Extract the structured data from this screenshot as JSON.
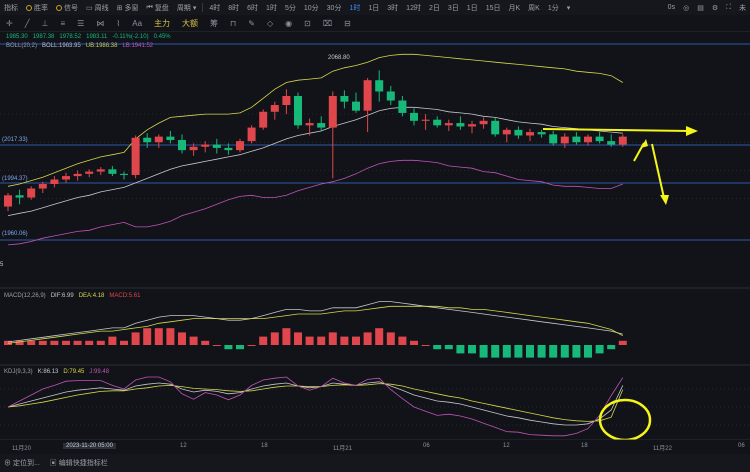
{
  "toolbar": {
    "left_items": [
      "指标",
      "胜率",
      "信号",
      "周线",
      "多窗",
      "复盘",
      "周期"
    ],
    "timeframes": [
      "4时",
      "8时",
      "6时",
      "1时",
      "5分",
      "10分",
      "30分",
      "1时",
      "1日",
      "3时",
      "12时",
      "2日",
      "3日",
      "1日",
      "15日",
      "月K",
      "周K",
      "1分"
    ],
    "active_timeframe_index": 7,
    "right_label": "0s",
    "far_right_label": "未"
  },
  "tools": {
    "labels": [
      "Aa",
      "主力",
      "大额",
      "筹"
    ],
    "icons": [
      "cursor-icon",
      "line-icon",
      "ruler-icon",
      "text-icon",
      "magnet-icon",
      "pen-icon",
      "eye-icon",
      "lock-icon",
      "trash-icon",
      "layers-icon",
      "grid-icon",
      "link-icon"
    ]
  },
  "ohlc_line": {
    "open": "1985.30",
    "high": "1987.38",
    "low": "1978.52",
    "close": "1983.11",
    "change": "-0.11%(-2.10)",
    "amplitude": "0.45%"
  },
  "boll": {
    "label": "BOLL(20,2)",
    "boll": "BOLL:1963.95",
    "ub": "UB:1986.38",
    "lb": "LB:1941.52"
  },
  "price_labels": {
    "high_label": "2068.80",
    "level1": "(2017.33)",
    "level2": "(1994.37)",
    "level3": "(1960.06)",
    "left_tick": "5"
  },
  "macd": {
    "label": "MACD(12,26,9)",
    "dif": "DIF:6.99",
    "dea": "DEA:4.18",
    "macd": "MACD:5.61"
  },
  "kdj": {
    "label": "KDJ(9,3,3)",
    "k": "K:86.13",
    "d": "D:79.45",
    "j": "J:99.48"
  },
  "xaxis": {
    "labels": [
      "11月20",
      "2023-11-20 05:00",
      "12",
      "18",
      "11月21",
      "06",
      "12",
      "18",
      "11月22",
      "06"
    ]
  },
  "footer": {
    "left": "定位到...",
    "right": "编辑快捷指标栏"
  },
  "colors": {
    "up": "#e0474c",
    "down": "#16b979",
    "boll_upper": "#d8d84a",
    "boll_mid": "#c5c8cf",
    "boll_lower": "#c054b8",
    "arrow": "#f5f51a",
    "circle": "#f5f51a",
    "level_line": "#3a6fd8"
  },
  "chart_data": {
    "type": "candlestick",
    "candles": [
      [
        1948,
        1960,
        1944,
        1958
      ],
      [
        1958,
        1963,
        1950,
        1956
      ],
      [
        1956,
        1966,
        1954,
        1964
      ],
      [
        1964,
        1970,
        1960,
        1968
      ],
      [
        1968,
        1975,
        1965,
        1972
      ],
      [
        1972,
        1978,
        1969,
        1975
      ],
      [
        1975,
        1980,
        1971,
        1977
      ],
      [
        1977,
        1981,
        1974,
        1979
      ],
      [
        1979,
        1983,
        1976,
        1981
      ],
      [
        1981,
        1984,
        1975,
        1977
      ],
      [
        1977,
        1979,
        1972,
        1976
      ],
      [
        1976,
        2011,
        1973,
        2009
      ],
      [
        2009,
        2013,
        2000,
        2005
      ],
      [
        2005,
        2012,
        2000,
        2010
      ],
      [
        2010,
        2015,
        2004,
        2007
      ],
      [
        2007,
        2012,
        1995,
        1998
      ],
      [
        1998,
        2004,
        1993,
        2001
      ],
      [
        2001,
        2006,
        1996,
        2003
      ],
      [
        2003,
        2008,
        1995,
        2000
      ],
      [
        2000,
        2004,
        1994,
        1998
      ],
      [
        1998,
        2008,
        1996,
        2006
      ],
      [
        2006,
        2020,
        2004,
        2018
      ],
      [
        2018,
        2034,
        2016,
        2032
      ],
      [
        2032,
        2041,
        2025,
        2038
      ],
      [
        2038,
        2052,
        2030,
        2046
      ],
      [
        2046,
        2049,
        2017,
        2020
      ],
      [
        2020,
        2026,
        2011,
        2022
      ],
      [
        2022,
        2028,
        2015,
        2018
      ],
      [
        2018,
        2050,
        1973,
        2046
      ],
      [
        2046,
        2051,
        2035,
        2041
      ],
      [
        2041,
        2049,
        2031,
        2033
      ],
      [
        2033,
        2062,
        2014,
        2060
      ],
      [
        2060,
        2068.8,
        2041,
        2050
      ],
      [
        2050,
        2055,
        2038,
        2042
      ],
      [
        2042,
        2046,
        2028,
        2031
      ],
      [
        2031,
        2035,
        2020,
        2024
      ],
      [
        2024,
        2030,
        2016,
        2025
      ],
      [
        2025,
        2028,
        2018,
        2020
      ],
      [
        2020,
        2025,
        2015,
        2022
      ],
      [
        2022,
        2028,
        2016,
        2019
      ],
      [
        2019,
        2024,
        2013,
        2021
      ],
      [
        2021,
        2027,
        2017,
        2024
      ],
      [
        2024,
        2027,
        2010,
        2012
      ],
      [
        2012,
        2018,
        2005,
        2016
      ],
      [
        2016,
        2019,
        2008,
        2011
      ],
      [
        2011,
        2017,
        2006,
        2014
      ],
      [
        2014,
        2016,
        2009,
        2012
      ],
      [
        2012,
        2015,
        2002,
        2004
      ],
      [
        2004,
        2013,
        2000,
        2010
      ],
      [
        2010,
        2014,
        2003,
        2005
      ],
      [
        2005,
        2012,
        2002,
        2010
      ],
      [
        2010,
        2014,
        2004,
        2006
      ],
      [
        2006,
        2012,
        2001,
        2003
      ],
      [
        2003,
        2012,
        2001,
        2010
      ]
    ],
    "series": [
      {
        "name": "BOLL:1963.95",
        "type": "line",
        "values": [
          1940,
          1942,
          1944,
          1947,
          1950,
          1953,
          1956,
          1958,
          1961,
          1963,
          1965,
          1969,
          1973,
          1977,
          1981,
          1984,
          1986,
          1988,
          1990,
          1992,
          1994,
          1997,
          2000,
          2004,
          2008,
          2011,
          2013,
          2015,
          2019,
          2022,
          2025,
          2029,
          2033,
          2035,
          2036,
          2036,
          2035,
          2034,
          2032,
          2031,
          2030,
          2028,
          2027,
          2025,
          2023,
          2022,
          2021,
          2019,
          2018,
          2017,
          2016,
          2015,
          2014,
          2013
        ]
      },
      {
        "name": "UB:1986.38",
        "type": "line",
        "values": [
          1966,
          1968,
          1971,
          1974,
          1978,
          1982,
          1986,
          1989,
          1992,
          1994,
          1996,
          2008,
          2016,
          2022,
          2027,
          2028,
          2029,
          2030,
          2030,
          2030,
          2031,
          2036,
          2044,
          2052,
          2058,
          2060,
          2061,
          2062,
          2068,
          2071,
          2073,
          2076,
          2080,
          2082,
          2083,
          2083,
          2082,
          2081,
          2080,
          2079,
          2078,
          2077,
          2076,
          2075,
          2074,
          2073,
          2072,
          2071,
          2070,
          2068,
          2067,
          2066,
          2064,
          2058
        ]
      },
      {
        "name": "LB:1941.52",
        "type": "line",
        "values": [
          1914,
          1915,
          1917,
          1920,
          1922,
          1924,
          1926,
          1927,
          1930,
          1932,
          1934,
          1930,
          1930,
          1932,
          1935,
          1940,
          1943,
          1946,
          1950,
          1954,
          1957,
          1958,
          1956,
          1956,
          1958,
          1962,
          1965,
          1968,
          1970,
          1973,
          1977,
          1982,
          1986,
          1988,
          1989,
          1989,
          1988,
          1987,
          1984,
          1983,
          1982,
          1979,
          1978,
          1975,
          1972,
          1971,
          1970,
          1967,
          1966,
          1966,
          1965,
          1964,
          1964,
          1968
        ]
      },
      {
        "name": "DIF:6.99",
        "type": "line",
        "values": [
          2,
          3,
          4,
          5,
          6,
          7,
          8,
          9,
          10,
          11,
          11,
          14,
          16,
          18,
          19,
          19,
          19,
          18,
          17,
          16,
          16,
          17,
          19,
          21,
          23,
          23,
          22,
          22,
          24,
          24,
          24,
          26,
          28,
          28,
          27,
          26,
          25,
          24,
          23,
          22,
          21,
          20,
          19,
          18,
          17,
          16,
          15,
          14,
          13,
          12,
          11,
          10,
          9,
          7
        ]
      },
      {
        "name": "DEA:4.18",
        "type": "line",
        "values": [
          1,
          2,
          3,
          4,
          5,
          6,
          7,
          8,
          9,
          9,
          10,
          11,
          12,
          14,
          15,
          16,
          17,
          17,
          17,
          17,
          17,
          17,
          17,
          18,
          19,
          20,
          20,
          20,
          21,
          22,
          22,
          23,
          24,
          25,
          25,
          25,
          25,
          25,
          24,
          24,
          23,
          23,
          22,
          21,
          20,
          19,
          18,
          17,
          16,
          15,
          14,
          12,
          10,
          6
        ]
      },
      {
        "name": "MACD:5.61",
        "type": "bar",
        "values": [
          1,
          1,
          1,
          1,
          1,
          1,
          1,
          1,
          1,
          2,
          1,
          3,
          4,
          4,
          4,
          3,
          2,
          1,
          0,
          -1,
          -1,
          0,
          2,
          3,
          4,
          3,
          2,
          2,
          3,
          2,
          2,
          3,
          4,
          3,
          2,
          1,
          0,
          -1,
          -1,
          -2,
          -2,
          -3,
          -3,
          -3,
          -3,
          -3,
          -3,
          -3,
          -3,
          -3,
          -3,
          -2,
          -1,
          1
        ]
      },
      {
        "name": "K:86.13",
        "type": "line",
        "values": [
          50,
          55,
          60,
          65,
          70,
          75,
          78,
          80,
          82,
          80,
          78,
          85,
          88,
          90,
          88,
          80,
          75,
          78,
          76,
          72,
          74,
          80,
          85,
          88,
          90,
          85,
          82,
          84,
          90,
          88,
          86,
          90,
          92,
          85,
          78,
          70,
          65,
          60,
          58,
          55,
          50,
          45,
          40,
          35,
          32,
          28,
          25,
          22,
          20,
          20,
          22,
          30,
          45,
          86
        ]
      },
      {
        "name": "D:79.45",
        "type": "line",
        "values": [
          50,
          52,
          55,
          58,
          62,
          66,
          70,
          73,
          76,
          77,
          77,
          80,
          82,
          85,
          86,
          84,
          81,
          80,
          79,
          77,
          76,
          77,
          80,
          83,
          85,
          85,
          84,
          84,
          86,
          87,
          86,
          87,
          89,
          88,
          85,
          80,
          76,
          72,
          68,
          65,
          60,
          56,
          52,
          48,
          44,
          40,
          36,
          32,
          29,
          27,
          26,
          27,
          33,
          79
        ]
      },
      {
        "name": "J:99.48",
        "type": "line",
        "values": [
          50,
          60,
          70,
          80,
          86,
          93,
          94,
          94,
          94,
          86,
          80,
          95,
          100,
          100,
          92,
          72,
          63,
          74,
          70,
          62,
          70,
          86,
          95,
          98,
          100,
          85,
          78,
          84,
          98,
          90,
          86,
          96,
          98,
          79,
          64,
          50,
          43,
          36,
          38,
          35,
          30,
          23,
          16,
          9,
          8,
          4,
          3,
          2,
          2,
          6,
          14,
          36,
          69,
          99
        ]
      }
    ],
    "ylim": [
      1890,
      2085
    ],
    "annotations": [
      "2068.80",
      "(2017.33)",
      "(1994.37)",
      "(1960.06)"
    ]
  }
}
